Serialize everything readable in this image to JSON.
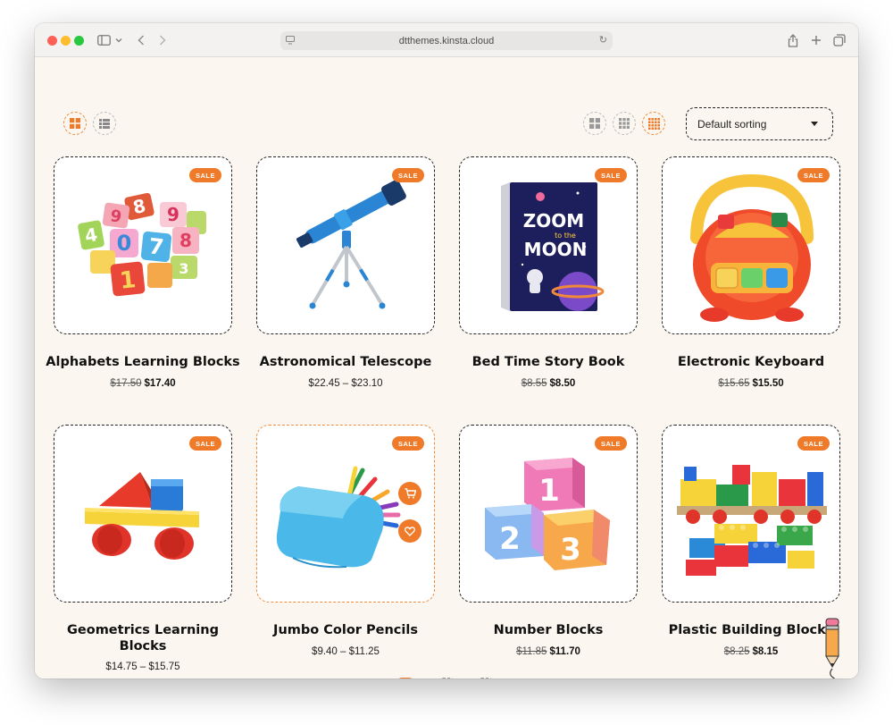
{
  "browser": {
    "url": "dtthemes.kinsta.cloud"
  },
  "toolbar": {
    "sort_label": "Default sorting"
  },
  "colors": {
    "accent": "#ef7b2a",
    "page_bg": "#fbf6ef"
  },
  "products": [
    {
      "name": "Alphabets Learning Blocks",
      "badge": "SALE",
      "old_price": "$17.50",
      "price": "$17.40",
      "range": ""
    },
    {
      "name": "Astronomical Telescope",
      "badge": "SALE",
      "old_price": "",
      "price": "",
      "range": "$22.45 – $23.10"
    },
    {
      "name": "Bed Time Story Book",
      "badge": "SALE",
      "old_price": "$8.55",
      "price": "$8.50",
      "range": "",
      "cover_text": [
        "ZOOM",
        "to the",
        "MOON"
      ]
    },
    {
      "name": "Electronic Keyboard",
      "badge": "SALE",
      "old_price": "$15.65",
      "price": "$15.50",
      "range": ""
    },
    {
      "name": "Geometrics Learning Blocks",
      "badge": "SALE",
      "old_price": "",
      "price": "",
      "range": "$14.75 – $15.75"
    },
    {
      "name": "Jumbo Color Pencils",
      "badge": "SALE",
      "old_price": "",
      "price": "",
      "range": "$9.40 – $11.25"
    },
    {
      "name": "Number Blocks",
      "badge": "SALE",
      "old_price": "$11.85",
      "price": "$11.70",
      "range": ""
    },
    {
      "name": "Plastic Building Blocks",
      "badge": "SALE",
      "old_price": "$8.25",
      "price": "$8.15",
      "range": ""
    }
  ]
}
